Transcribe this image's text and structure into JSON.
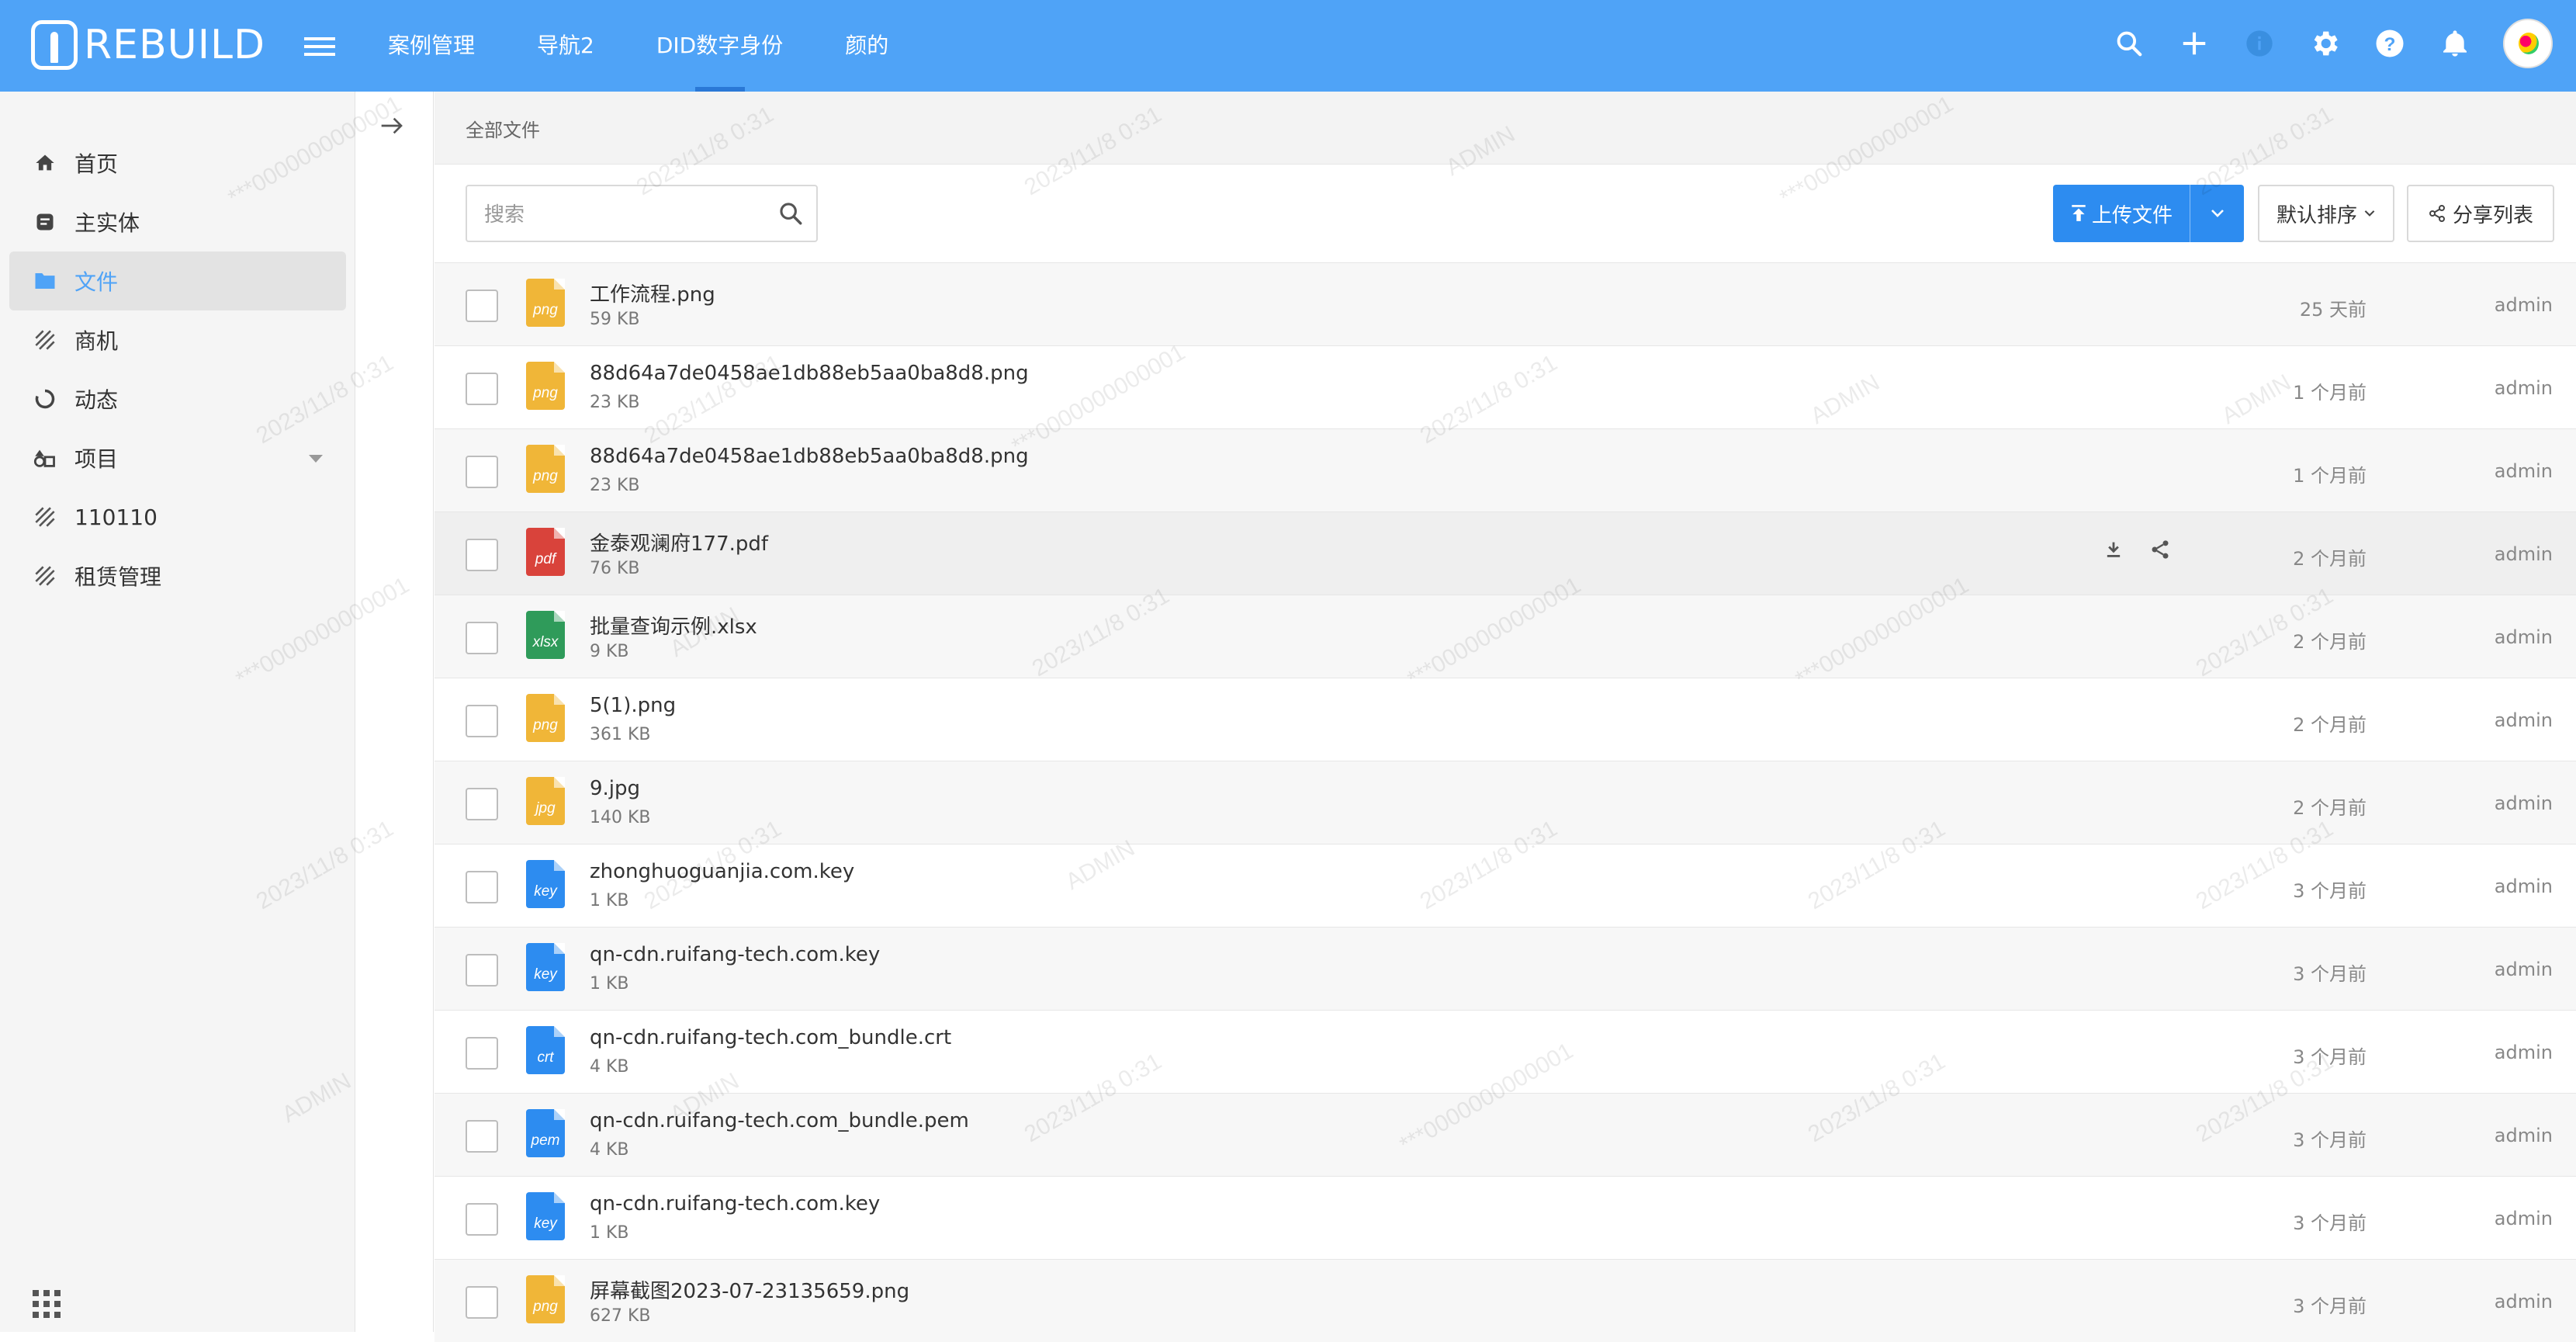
{
  "app": {
    "logo_text": "REBUILD"
  },
  "topnav": {
    "items": [
      "案例管理",
      "导航2",
      "DID数字身份",
      "颜的"
    ],
    "active_index": 2
  },
  "top_icons": [
    "search-icon",
    "plus-icon",
    "info-icon",
    "gear-icon",
    "help-icon",
    "bell-icon",
    "avatar"
  ],
  "sidebar": {
    "items": [
      {
        "label": "首页",
        "icon": "home-icon"
      },
      {
        "label": "主实体",
        "icon": "entity-icon"
      },
      {
        "label": "文件",
        "icon": "folder-icon",
        "active": true
      },
      {
        "label": "商机",
        "icon": "stripe-icon"
      },
      {
        "label": "动态",
        "icon": "circle-icon"
      },
      {
        "label": "项目",
        "icon": "project-icon",
        "has_submenu": true
      },
      {
        "label": "110110",
        "icon": "stripe-icon"
      },
      {
        "label": "租赁管理",
        "icon": "stripe-icon"
      }
    ]
  },
  "breadcrumb": {
    "label": "全部文件"
  },
  "toolbar": {
    "search_placeholder": "搜索",
    "upload_label": "上传文件",
    "sort_label": "默认排序",
    "share_label": "分享列表"
  },
  "files": [
    {
      "name": "工作流程.png",
      "size": "59 KB",
      "type": "png",
      "time": "25 天前",
      "user": "admin"
    },
    {
      "name": "88d64a7de0458ae1db88eb5aa0ba8d8.png",
      "size": "23 KB",
      "type": "png",
      "time": "1 个月前",
      "user": "admin"
    },
    {
      "name": "88d64a7de0458ae1db88eb5aa0ba8d8.png",
      "size": "23 KB",
      "type": "png",
      "time": "1 个月前",
      "user": "admin"
    },
    {
      "name": "金泰观澜府177.pdf",
      "size": "76 KB",
      "type": "pdf",
      "time": "2 个月前",
      "user": "admin",
      "hover": true
    },
    {
      "name": "批量查询示例.xlsx",
      "size": "9 KB",
      "type": "xlsx",
      "time": "2 个月前",
      "user": "admin"
    },
    {
      "name": "5(1).png",
      "size": "361 KB",
      "type": "png",
      "time": "2 个月前",
      "user": "admin"
    },
    {
      "name": "9.jpg",
      "size": "140 KB",
      "type": "jpg",
      "time": "2 个月前",
      "user": "admin"
    },
    {
      "name": "zhonghuoguanjia.com.key",
      "size": "1 KB",
      "type": "key",
      "time": "3 个月前",
      "user": "admin"
    },
    {
      "name": "qn-cdn.ruifang-tech.com.key",
      "size": "1 KB",
      "type": "key",
      "time": "3 个月前",
      "user": "admin"
    },
    {
      "name": "qn-cdn.ruifang-tech.com_bundle.crt",
      "size": "4 KB",
      "type": "crt",
      "time": "3 个月前",
      "user": "admin"
    },
    {
      "name": "qn-cdn.ruifang-tech.com_bundle.pem",
      "size": "4 KB",
      "type": "pem",
      "time": "3 个月前",
      "user": "admin"
    },
    {
      "name": "qn-cdn.ruifang-tech.com.key",
      "size": "1 KB",
      "type": "key",
      "time": "3 个月前",
      "user": "admin"
    },
    {
      "name": "屏幕截图2023-07-23135659.png",
      "size": "627 KB",
      "type": "png",
      "time": "3 个月前",
      "user": "admin"
    }
  ],
  "file_type_labels": {
    "png": "png",
    "jpg": "jpg",
    "pdf": "pdf",
    "xlsx": "xlsx",
    "key": "key",
    "crt": "crt",
    "pem": "pem"
  },
  "watermark": {
    "texts": [
      "2023/11/8 0:31",
      "ADMIN",
      "***0000000000001"
    ]
  }
}
